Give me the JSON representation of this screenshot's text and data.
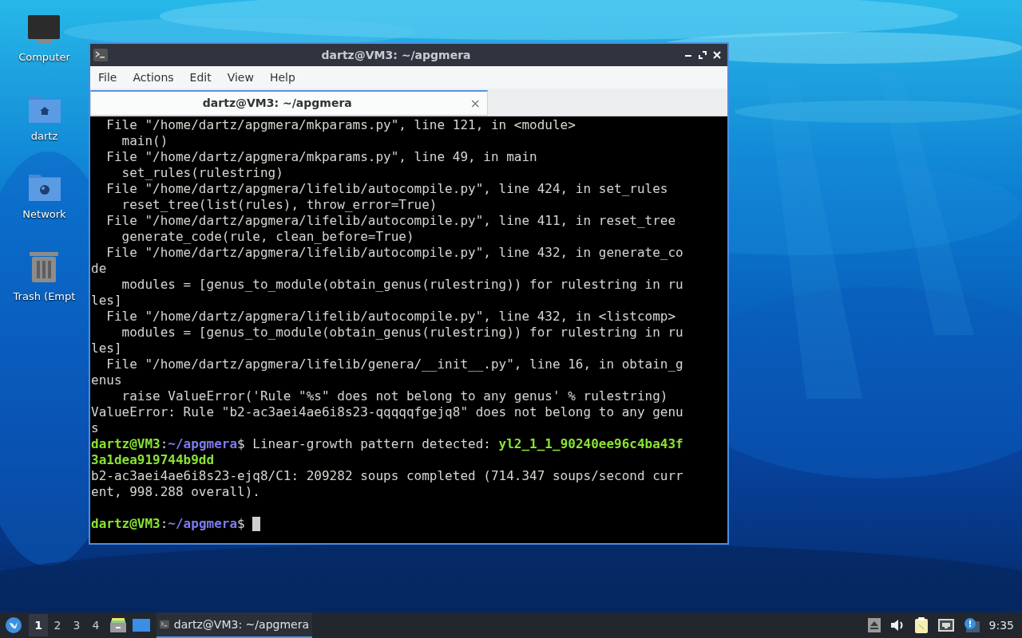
{
  "desktop_icons": [
    {
      "label": "Computer",
      "kind": "computer"
    },
    {
      "label": "dartz",
      "kind": "home"
    },
    {
      "label": "Network",
      "kind": "network"
    },
    {
      "label": "Trash (Empt",
      "kind": "trash"
    }
  ],
  "window": {
    "title": "dartz@VM3: ~/apgmera",
    "menu": [
      "File",
      "Actions",
      "Edit",
      "View",
      "Help"
    ],
    "tabs": [
      {
        "label": "dartz@VM3: ~/apgmera",
        "selected": true,
        "close": "×"
      }
    ],
    "terminal": {
      "lines": [
        {
          "segments": [
            {
              "kind": "plain",
              "text": "  File \"/home/dartz/apgmera/mkparams.py\", line 121, in <module>"
            }
          ]
        },
        {
          "segments": [
            {
              "kind": "plain",
              "text": "    main()"
            }
          ]
        },
        {
          "segments": [
            {
              "kind": "plain",
              "text": "  File \"/home/dartz/apgmera/mkparams.py\", line 49, in main"
            }
          ]
        },
        {
          "segments": [
            {
              "kind": "plain",
              "text": "    set_rules(rulestring)"
            }
          ]
        },
        {
          "segments": [
            {
              "kind": "plain",
              "text": "  File \"/home/dartz/apgmera/lifelib/autocompile.py\", line 424, in set_rules"
            }
          ]
        },
        {
          "segments": [
            {
              "kind": "plain",
              "text": "    reset_tree(list(rules), throw_error=True)"
            }
          ]
        },
        {
          "segments": [
            {
              "kind": "plain",
              "text": "  File \"/home/dartz/apgmera/lifelib/autocompile.py\", line 411, in reset_tree"
            }
          ]
        },
        {
          "segments": [
            {
              "kind": "plain",
              "text": "    generate_code(rule, clean_before=True)"
            }
          ]
        },
        {
          "segments": [
            {
              "kind": "plain",
              "text": "  File \"/home/dartz/apgmera/lifelib/autocompile.py\", line 432, in generate_co"
            }
          ]
        },
        {
          "segments": [
            {
              "kind": "plain",
              "text": "de"
            }
          ]
        },
        {
          "segments": [
            {
              "kind": "plain",
              "text": "    modules = [genus_to_module(obtain_genus(rulestring)) for rulestring in ru"
            }
          ]
        },
        {
          "segments": [
            {
              "kind": "plain",
              "text": "les]"
            }
          ]
        },
        {
          "segments": [
            {
              "kind": "plain",
              "text": "  File \"/home/dartz/apgmera/lifelib/autocompile.py\", line 432, in <listcomp>"
            }
          ]
        },
        {
          "segments": [
            {
              "kind": "plain",
              "text": "    modules = [genus_to_module(obtain_genus(rulestring)) for rulestring in ru"
            }
          ]
        },
        {
          "segments": [
            {
              "kind": "plain",
              "text": "les]"
            }
          ]
        },
        {
          "segments": [
            {
              "kind": "plain",
              "text": "  File \"/home/dartz/apgmera/lifelib/genera/__init__.py\", line 16, in obtain_g"
            }
          ]
        },
        {
          "segments": [
            {
              "kind": "plain",
              "text": "enus"
            }
          ]
        },
        {
          "segments": [
            {
              "kind": "plain",
              "text": "    raise ValueError('Rule \"%s\" does not belong to any genus' % rulestring)"
            }
          ]
        },
        {
          "segments": [
            {
              "kind": "plain",
              "text": "ValueError: Rule \"b2-ac3aei4ae6i8s23-qqqqqfgejq8\" does not belong to any genu"
            }
          ]
        },
        {
          "segments": [
            {
              "kind": "plain",
              "text": "s"
            }
          ]
        },
        {
          "segments": [
            {
              "kind": "user",
              "text": "dartz@VM3"
            },
            {
              "kind": "plain",
              "text": ":"
            },
            {
              "kind": "path",
              "text": "~/apgmera"
            },
            {
              "kind": "plain",
              "text": "$ Linear-growth pattern detected: "
            },
            {
              "kind": "highlight",
              "text": "yl2_1_1_90240ee96c4ba43f"
            }
          ]
        },
        {
          "segments": [
            {
              "kind": "highlight",
              "text": "3a1dea919744b9dd"
            }
          ]
        },
        {
          "segments": [
            {
              "kind": "plain",
              "text": "b2-ac3aei4ae6i8s23-ejq8/C1: 209282 soups completed (714.347 soups/second curr"
            }
          ]
        },
        {
          "segments": [
            {
              "kind": "plain",
              "text": "ent, 998.288 overall)."
            }
          ]
        },
        {
          "segments": [
            {
              "kind": "user",
              "text": "dartz@VM3"
            },
            {
              "kind": "plain",
              "text": ":"
            },
            {
              "kind": "path",
              "text": "~/apgmera"
            },
            {
              "kind": "plain",
              "text": "$ "
            }
          ],
          "cursor": true
        }
      ]
    }
  },
  "taskbar": {
    "workspaces": [
      {
        "label": "1",
        "selected": true
      },
      {
        "label": "2",
        "selected": false
      },
      {
        "label": "3",
        "selected": false
      },
      {
        "label": "4",
        "selected": false
      }
    ],
    "launchers": [
      {
        "kind": "files"
      },
      {
        "kind": "desktop"
      }
    ],
    "tasks": [
      {
        "label": "dartz@VM3: ~/apgmera",
        "selected": true
      }
    ],
    "tray": [
      {
        "kind": "eject"
      },
      {
        "kind": "volume"
      },
      {
        "kind": "clipboard"
      },
      {
        "kind": "network"
      },
      {
        "kind": "notification"
      }
    ],
    "clock": "9:35"
  }
}
